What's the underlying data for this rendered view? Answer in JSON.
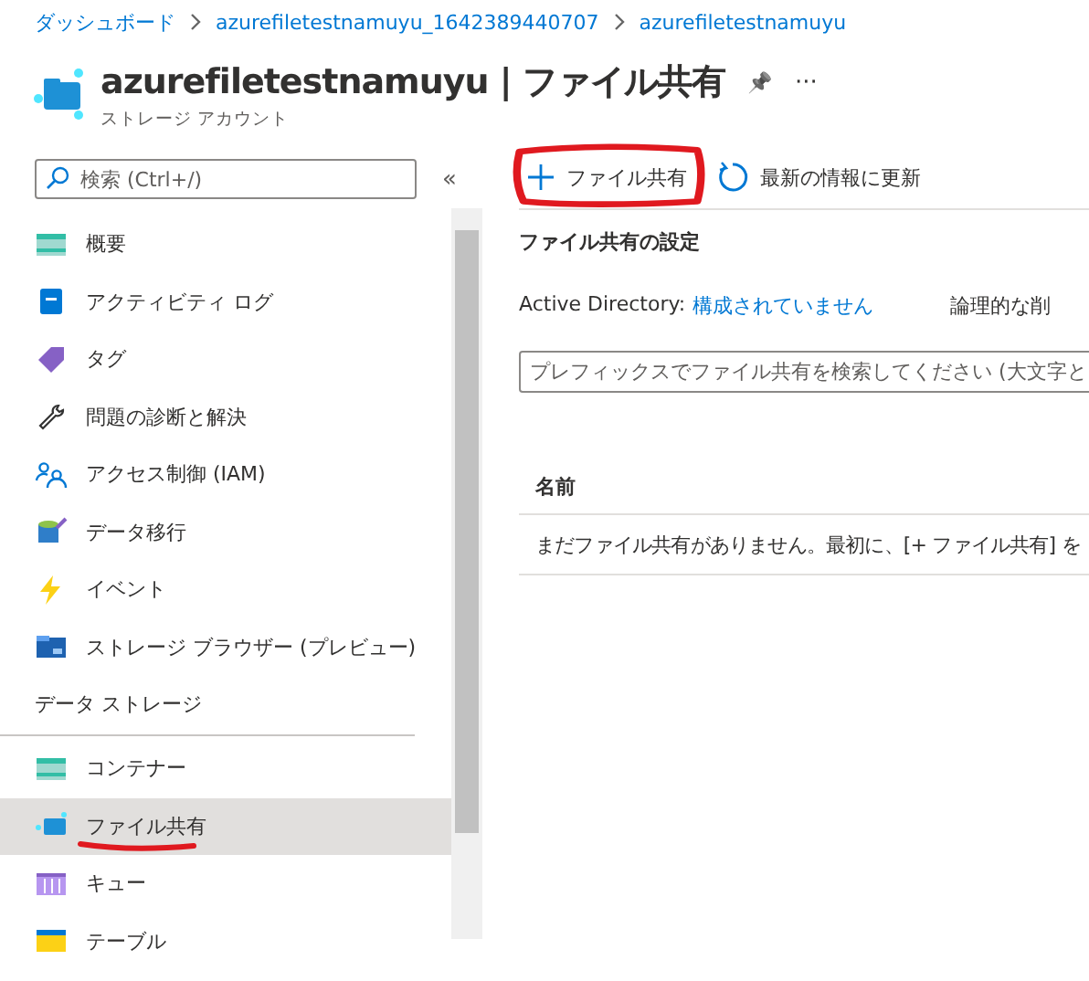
{
  "breadcrumb": [
    "ダッシュボード",
    "azurefiletestnamuyu_1642389440707",
    "azurefiletestnamuyu"
  ],
  "header": {
    "title": "azurefiletestnamuyu | ファイル共有",
    "subtitle": "ストレージ アカウント",
    "pin": "📌",
    "more": "···"
  },
  "sidebar": {
    "search": {
      "placeholder": "検索 (Ctrl+/)"
    },
    "collapse": "«",
    "items": [
      {
        "kind": "item",
        "label": "概要",
        "selected": false
      },
      {
        "kind": "item",
        "label": "アクティビティ ログ",
        "selected": false
      },
      {
        "kind": "item",
        "label": "タグ",
        "selected": false
      },
      {
        "kind": "item",
        "label": "問題の診断と解決",
        "selected": false
      },
      {
        "kind": "item",
        "label": "アクセス制御 (IAM)",
        "selected": false
      },
      {
        "kind": "item",
        "label": "データ移行",
        "selected": false
      },
      {
        "kind": "item",
        "label": "イベント",
        "selected": false
      },
      {
        "kind": "item",
        "label": "ストレージ ブラウザー (プレビュー)",
        "selected": false
      },
      {
        "kind": "section",
        "label": "データ ストレージ"
      },
      {
        "kind": "item",
        "label": "コンテナー",
        "selected": false
      },
      {
        "kind": "item",
        "label": "ファイル共有",
        "selected": true,
        "underlined": true
      },
      {
        "kind": "item",
        "label": "キュー",
        "selected": false
      },
      {
        "kind": "item",
        "label": "テーブル",
        "selected": false
      }
    ]
  },
  "toolbar": [
    {
      "kind": "add",
      "label": "ファイル共有",
      "circled": true
    },
    {
      "kind": "refresh",
      "label": "最新の情報に更新",
      "circled": false
    }
  ],
  "settings": {
    "heading": "ファイル共有の設定",
    "active_directory_label": "Active Directory:",
    "active_directory_value": "構成されていません",
    "soft_delete_label": "論理的な削"
  },
  "filter": {
    "placeholder": "プレフィックスでファイル共有を検索してください (大文字と"
  },
  "table": {
    "columns": [
      "名前"
    ],
    "empty_message": "まだファイル共有がありません。最初に、[+ ファイル共有] を"
  }
}
